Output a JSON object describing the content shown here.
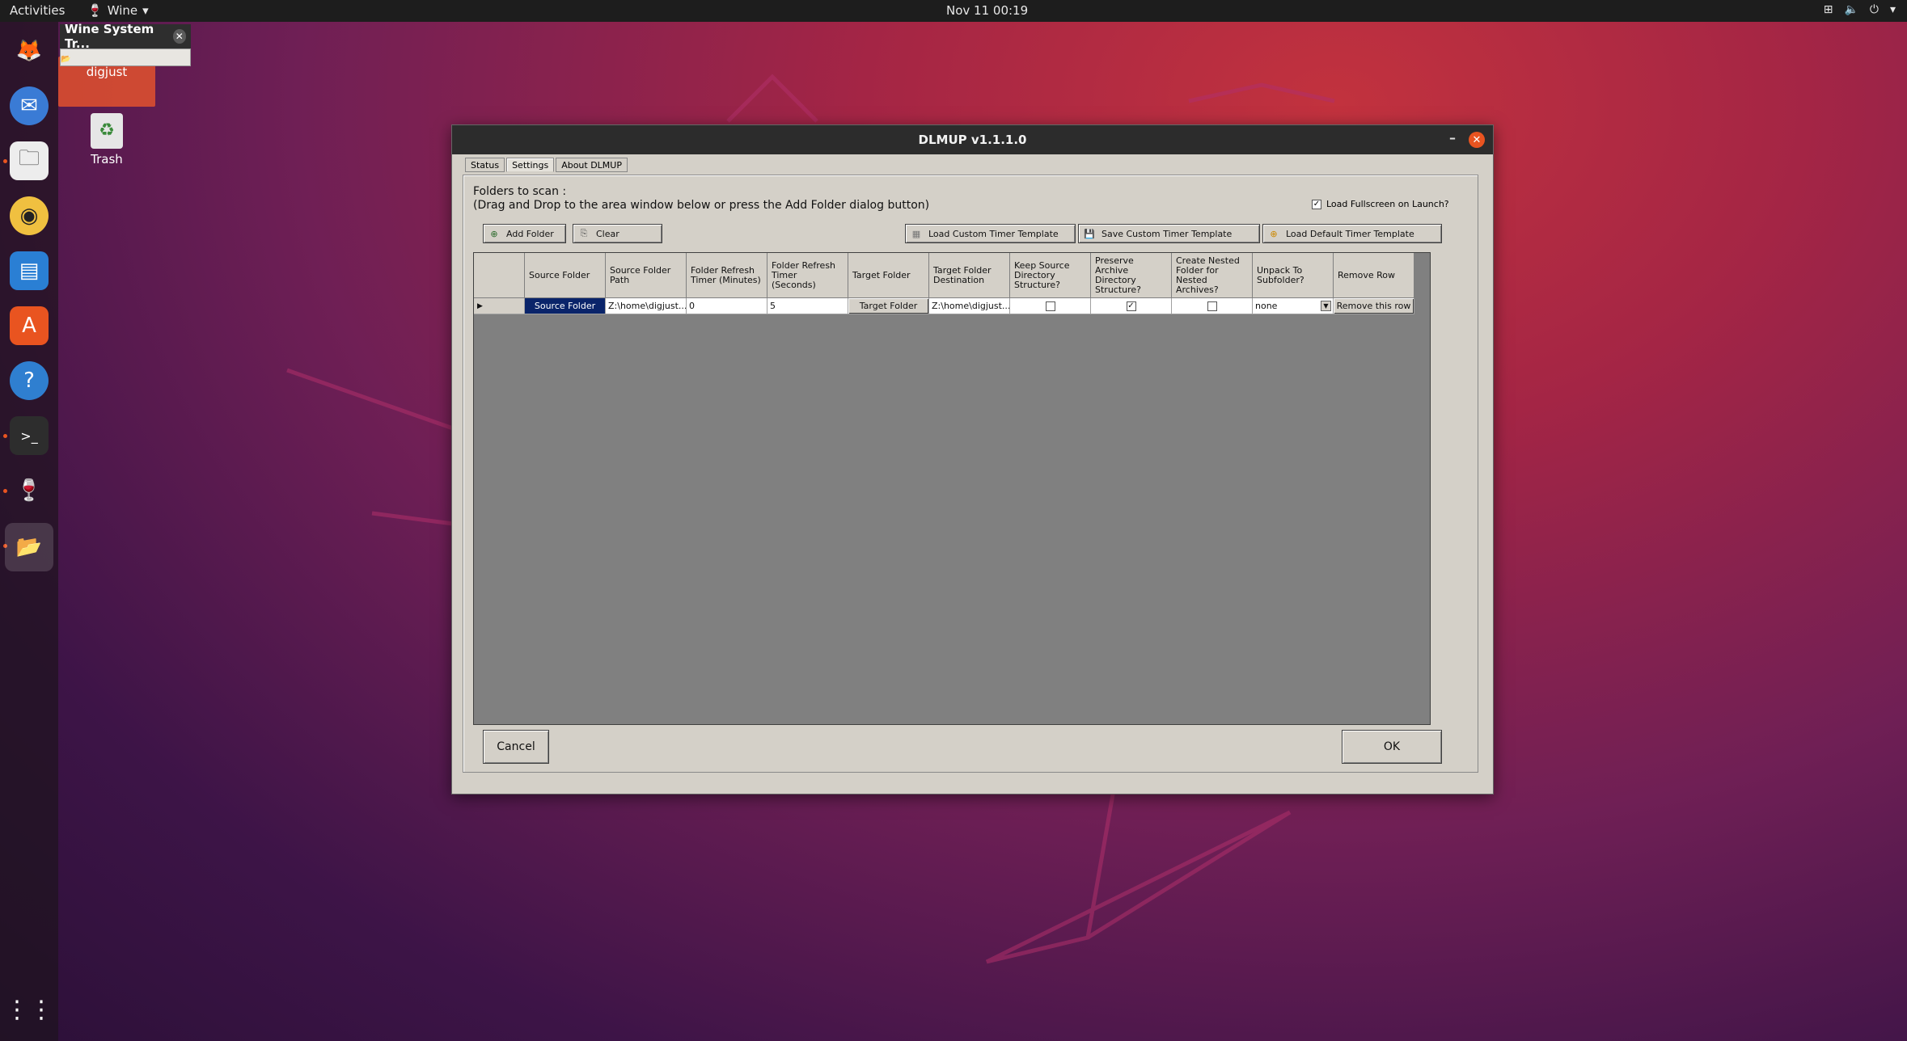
{
  "topbar": {
    "activities": "Activities",
    "app_name": "Wine",
    "clock": "Nov 11  00:19"
  },
  "wine_tray": {
    "title": "Wine System Tr..."
  },
  "desktop": {
    "folder_label": "digjust",
    "trash_label": "Trash"
  },
  "dialog": {
    "title": "DLMUP v1.1.1.0",
    "tabs": [
      {
        "label": "Status"
      },
      {
        "label": "Settings"
      },
      {
        "label": "About DLMUP"
      }
    ],
    "scan_label_1": "Folders to scan :",
    "scan_label_2": "(Drag and Drop to the area window below or press the Add Folder dialog button)",
    "load_fullscreen_label": "Load Fullscreen on Launch?",
    "buttons": {
      "add_folder": "Add Folder",
      "clear": "Clear",
      "load_custom": "Load Custom Timer Template",
      "save_custom": "Save Custom Timer Template",
      "load_default": "Load Default Timer Template",
      "cancel": "Cancel",
      "ok": "OK"
    },
    "columns": [
      "Source Folder",
      "Source Folder Path",
      "Folder Refresh Timer (Minutes)",
      "Folder Refresh Timer (Seconds)",
      "Target Folder",
      "Target Folder Destination",
      "Keep Source Directory Structure?",
      "Preserve Archive Directory Structure?",
      "Create Nested Folder for Nested Archives?",
      "Unpack To Subfolder?",
      "Remove Row"
    ],
    "row": {
      "source_folder": "Source Folder",
      "source_path": "Z:\\home\\digjust...",
      "minutes": "0",
      "seconds": "5",
      "target_folder": "Target Folder",
      "target_dest": "Z:\\home\\digjust...",
      "keep_source": false,
      "preserve_archive": true,
      "create_nested": false,
      "unpack": "none",
      "remove": "Remove this row"
    }
  },
  "colors": {
    "accent": "#e95420",
    "selection": "#0a246a",
    "dialog_bg": "#d4d0c8",
    "grid_bg": "#808080"
  }
}
